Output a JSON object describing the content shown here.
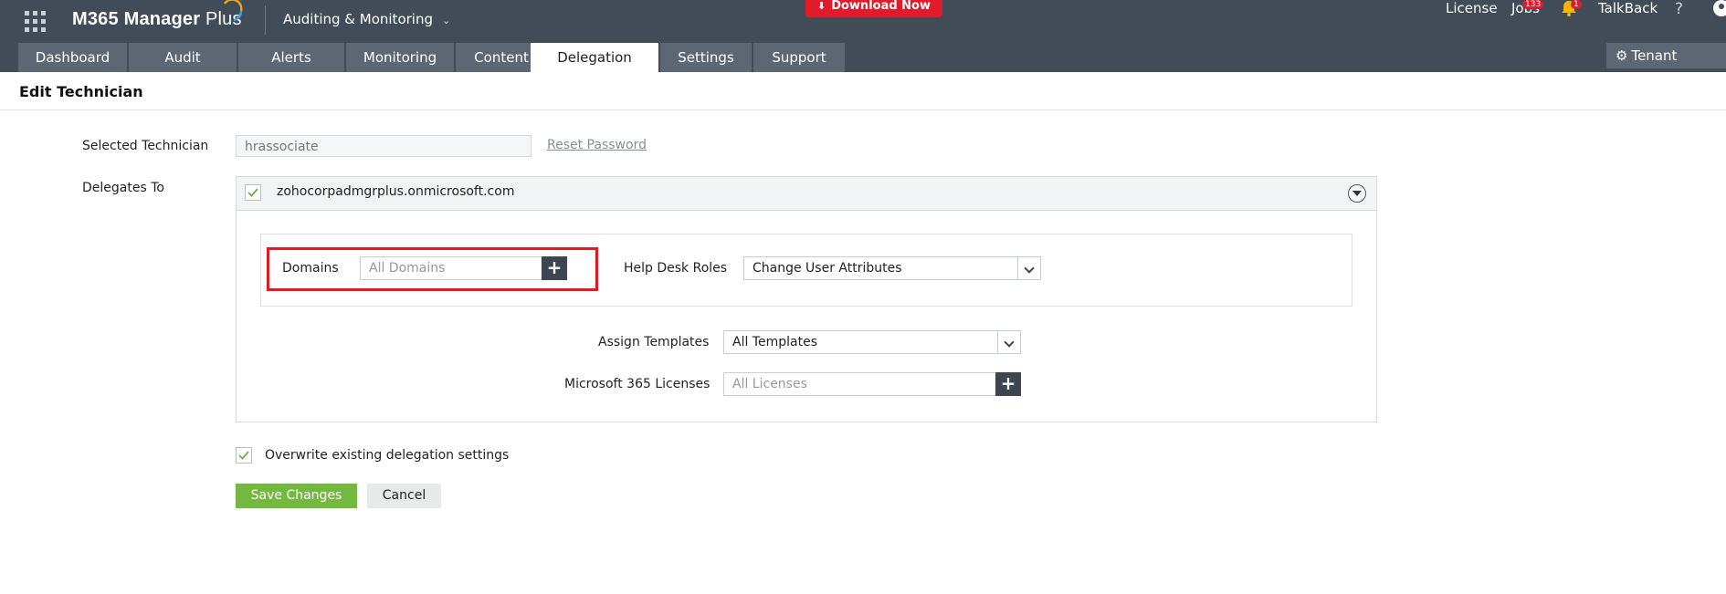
{
  "header": {
    "brand": "M365 Manager",
    "brand_suffix": "Plus",
    "product_menu": "Auditing & Monitoring",
    "download_label": "Download Now",
    "links": {
      "license": "License",
      "jobs": "Jobs",
      "jobs_badge": "133",
      "notifications_badge": "1",
      "talkback": "TalkBack",
      "help": "?"
    },
    "tenant_settings": "Tenant Settings"
  },
  "nav": {
    "tabs": [
      {
        "label": "Dashboard"
      },
      {
        "label": "Audit"
      },
      {
        "label": "Alerts"
      },
      {
        "label": "Monitoring"
      },
      {
        "label": "Content Search"
      },
      {
        "label": "Delegation"
      },
      {
        "label": "Settings"
      },
      {
        "label": "Support"
      }
    ],
    "active": "Delegation"
  },
  "page": {
    "title": "Edit Technician"
  },
  "form": {
    "selected_technician_label": "Selected Technician",
    "selected_technician_value": "hrassociate",
    "reset_password": "Reset Password",
    "delegates_to_label": "Delegates To",
    "tenant": "zohocorpadmgrplus.onmicrosoft.com",
    "domains_label": "Domains",
    "domains_placeholder": "All Domains",
    "help_desk_roles_label": "Help Desk Roles",
    "help_desk_roles_value": "Change User Attributes",
    "assign_templates_label": "Assign Templates",
    "assign_templates_value": "All Templates",
    "licenses_label": "Microsoft 365 Licenses",
    "licenses_placeholder": "All Licenses",
    "overwrite_label": "Overwrite existing delegation settings",
    "save_label": "Save Changes",
    "cancel_label": "Cancel"
  },
  "colors": {
    "header_bg": "#414c58",
    "tab_bg": "#5c6773",
    "download_red": "#e21b2c",
    "save_green": "#74b840",
    "highlight_red": "#e01b24"
  }
}
